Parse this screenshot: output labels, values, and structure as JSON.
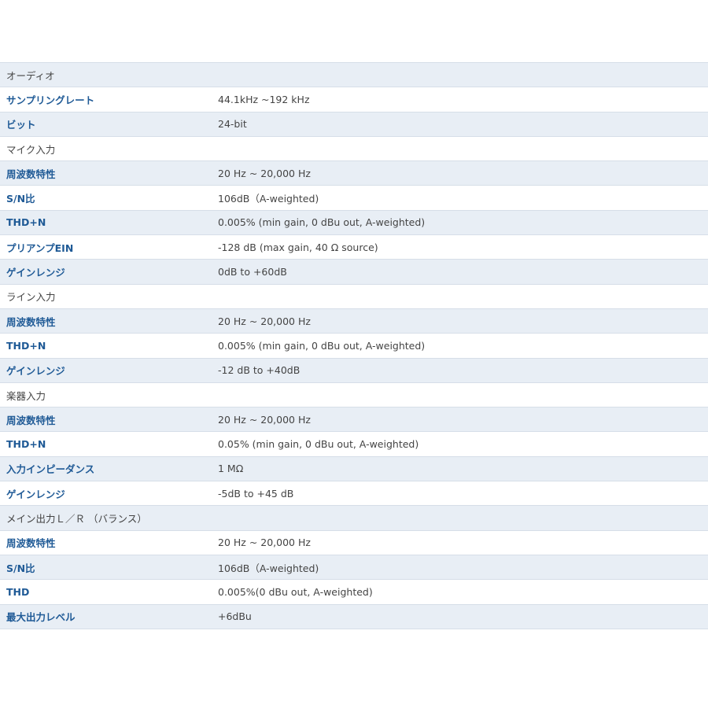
{
  "sections": [
    {
      "heading": "オーディオ",
      "rows": [
        {
          "label": "サンプリングレート",
          "value": "44.1kHz ~192 kHz"
        },
        {
          "label": "ビット",
          "value": "24-bit"
        }
      ]
    },
    {
      "heading": "マイク入力",
      "rows": [
        {
          "label": "周波数特性",
          "value": "20 Hz ~ 20,000 Hz"
        },
        {
          "label": "S/N比",
          "value": "106dB（A-weighted)"
        },
        {
          "label": "THD+N",
          "value": "0.005% (min gain, 0 dBu out, A-weighted)"
        },
        {
          "label": "プリアンプEIN",
          "value": "-128 dB (max gain, 40 Ω source)"
        },
        {
          "label": "ゲインレンジ",
          "value": "0dB to +60dB"
        }
      ]
    },
    {
      "heading": "ライン入力",
      "rows": [
        {
          "label": "周波数特性",
          "value": "20 Hz ~ 20,000 Hz"
        },
        {
          "label": "THD+N",
          "value": "0.005% (min gain, 0 dBu out, A-weighted)"
        },
        {
          "label": "ゲインレンジ",
          "value": "-12 dB to +40dB"
        }
      ]
    },
    {
      "heading": "楽器入力",
      "rows": [
        {
          "label": "周波数特性",
          "value": "20 Hz ~ 20,000 Hz"
        },
        {
          "label": "THD+N",
          "value": "0.05% (min gain, 0 dBu out, A-weighted)"
        },
        {
          "label": "入力インピーダンス",
          "value": "1 MΩ"
        },
        {
          "label": "ゲインレンジ",
          "value": "-5dB to +45 dB"
        }
      ]
    },
    {
      "heading": "メイン出力Ｌ／Ｒ （バランス）",
      "rows": [
        {
          "label": "周波数特性",
          "value": "20 Hz ~ 20,000 Hz"
        },
        {
          "label": "S/N比",
          "value": "106dB（A-weighted)"
        },
        {
          "label": "THD",
          "value": "0.005%(0 dBu out, A-weighted)"
        },
        {
          "label": "最大出力レベル",
          "value": "+6dBu"
        }
      ]
    }
  ]
}
